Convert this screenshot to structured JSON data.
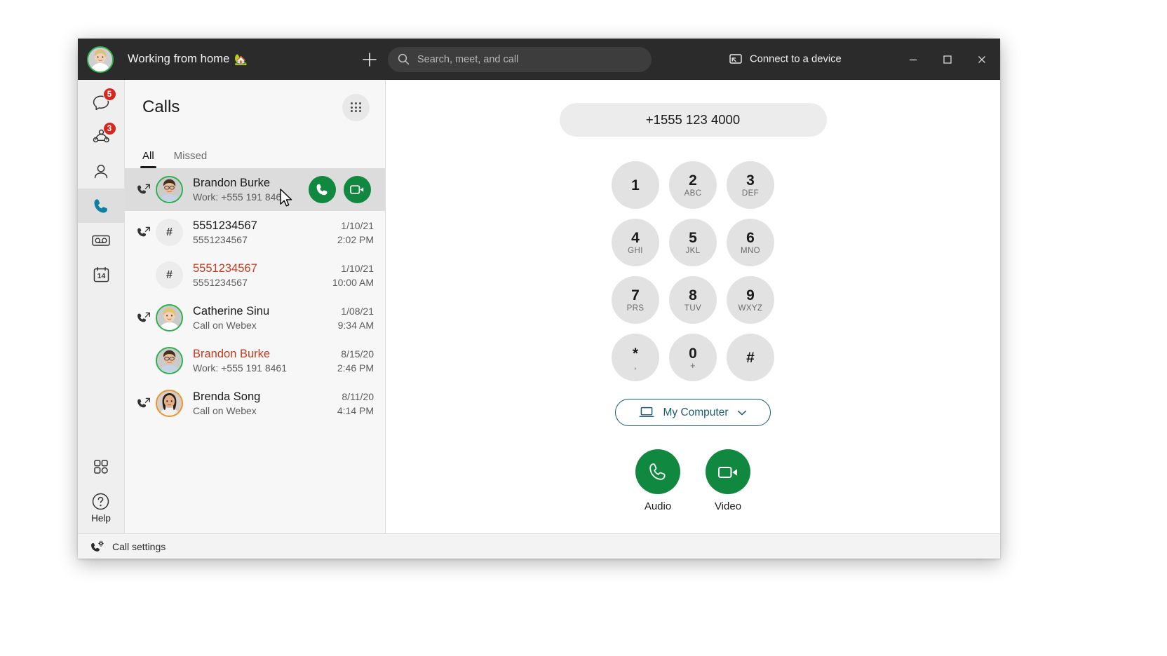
{
  "titlebar": {
    "status_text": "Working from home",
    "status_emoji": "🏡",
    "plus_icon": "plus-icon",
    "search_placeholder": "Search, meet, and call",
    "search_value": "",
    "search_icon": "search-icon",
    "connect_device_label": "Connect to a device",
    "connect_device_icon": "screen-share-icon",
    "minimize_label": "Minimize",
    "maximize_label": "Maximize",
    "close_label": "Close",
    "avatar_name": "user-avatar"
  },
  "rail": {
    "items": [
      {
        "name": "messaging",
        "icon": "chat-bubble-icon",
        "badge": "5",
        "active": false
      },
      {
        "name": "teams",
        "icon": "teams-icon",
        "badge": "3",
        "active": false
      },
      {
        "name": "contacts",
        "icon": "person-icon",
        "badge": "",
        "active": false
      },
      {
        "name": "calls",
        "icon": "phone-icon",
        "badge": "",
        "active": true
      },
      {
        "name": "voicemail",
        "icon": "voicemail-icon",
        "badge": "",
        "active": false
      },
      {
        "name": "calendar",
        "icon": "calendar-icon",
        "badge": "",
        "active": false,
        "day": "14"
      }
    ],
    "apps_icon": "apps-grid-icon",
    "help_icon": "question-circle-icon",
    "help_label": "Help"
  },
  "calls_panel": {
    "title": "Calls",
    "dialpad_icon": "dialpad-grid-icon",
    "tabs": [
      {
        "label": "All",
        "active": true
      },
      {
        "label": "Missed",
        "active": false
      }
    ],
    "rows": [
      {
        "name": "Brandon Burke",
        "sub": "Work: +555 191 846",
        "date": "",
        "time": "",
        "missed": false,
        "direction_icon": "outgoing-call-icon",
        "avatar_type": "photo-male",
        "ring": "green",
        "hovered": true,
        "audio_button": "audio-call-button",
        "video_button": "video-call-button"
      },
      {
        "name": "5551234567",
        "sub": "5551234567",
        "date": "1/10/21",
        "time": "2:02 PM",
        "missed": false,
        "direction_icon": "outgoing-call-icon",
        "avatar_type": "hash",
        "avatar_glyph": "#",
        "ring": "none",
        "hovered": false
      },
      {
        "name": "5551234567",
        "sub": "5551234567",
        "date": "1/10/21",
        "time": "10:00 AM",
        "missed": true,
        "direction_icon": "none",
        "avatar_type": "hash",
        "avatar_glyph": "#",
        "ring": "none",
        "hovered": false
      },
      {
        "name": "Catherine Sinu",
        "sub": "Call on Webex",
        "date": "1/08/21",
        "time": "9:34 AM",
        "missed": false,
        "direction_icon": "outgoing-call-icon",
        "avatar_type": "photo-female-blonde",
        "ring": "green",
        "hovered": false
      },
      {
        "name": "Brandon Burke",
        "sub": "Work: +555 191 8461",
        "date": "8/15/20",
        "time": "2:46 PM",
        "missed": true,
        "direction_icon": "none",
        "avatar_type": "photo-male",
        "ring": "green",
        "hovered": false
      },
      {
        "name": "Brenda Song",
        "sub": "Call on Webex",
        "date": "8/11/20",
        "time": "4:14 PM",
        "missed": false,
        "direction_icon": "outgoing-call-icon",
        "avatar_type": "photo-female-dark",
        "ring": "orange",
        "hovered": false
      }
    ]
  },
  "dialer": {
    "number": "+1555 123 4000",
    "keys": [
      {
        "digit": "1",
        "letters": ""
      },
      {
        "digit": "2",
        "letters": "ABC"
      },
      {
        "digit": "3",
        "letters": "DEF"
      },
      {
        "digit": "4",
        "letters": "GHI"
      },
      {
        "digit": "5",
        "letters": "JKL"
      },
      {
        "digit": "6",
        "letters": "MNO"
      },
      {
        "digit": "7",
        "letters": "PRS"
      },
      {
        "digit": "8",
        "letters": "TUV"
      },
      {
        "digit": "9",
        "letters": "WXYZ"
      },
      {
        "digit": "*",
        "letters": ","
      },
      {
        "digit": "0",
        "letters": "+"
      },
      {
        "digit": "#",
        "letters": ""
      }
    ],
    "device_label": "My Computer",
    "device_icon": "laptop-icon",
    "device_chevron": "chevron-down-icon",
    "audio_label": "Audio",
    "audio_icon": "phone-icon",
    "video_label": "Video",
    "video_icon": "video-camera-icon"
  },
  "status_bar": {
    "label": "Call settings",
    "icon": "call-settings-icon"
  },
  "colors": {
    "titlebar_bg": "#2b2b2b",
    "green": "#11883f",
    "presence_green": "#2cb14d",
    "presence_orange": "#f0922b",
    "badge_red": "#d4291f",
    "missed_red": "#c23b20",
    "device_teal": "#1b5a73",
    "active_rail_blue": "#0f7fa3"
  }
}
